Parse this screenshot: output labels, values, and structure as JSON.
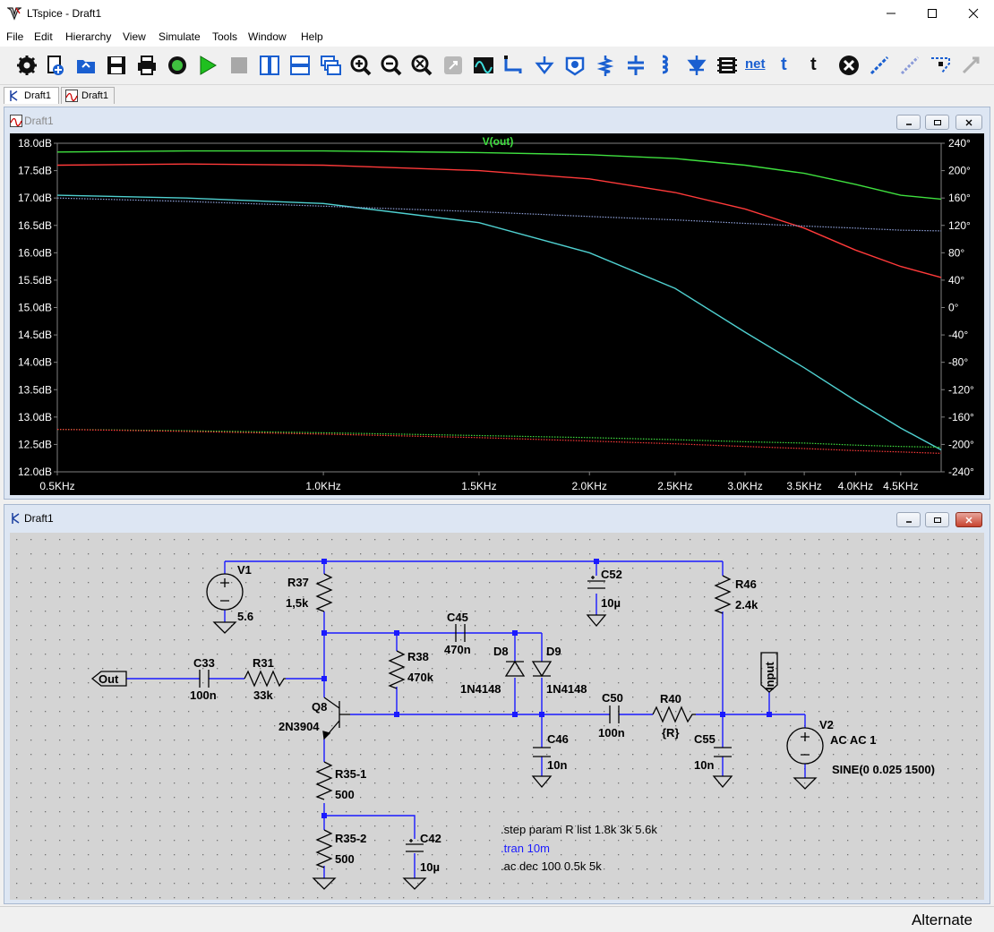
{
  "window": {
    "title": "LTspice - Draft1"
  },
  "menu": [
    "File",
    "Edit",
    "Hierarchy",
    "View",
    "Simulate",
    "Tools",
    "Window",
    "Help"
  ],
  "toolbar": {
    "net_label": "net",
    "t_label": "t"
  },
  "tabs": [
    "Draft1",
    "Draft1"
  ],
  "plot_window": {
    "title": "Draft1"
  },
  "schematic_window": {
    "title": "Draft1"
  },
  "status": {
    "text": "Alternate"
  },
  "chart_data": {
    "type": "line",
    "title": "V(out)",
    "xscale": "log",
    "xlim": [
      500,
      5000
    ],
    "x_ticks": [
      "0.5KHz",
      "1.0KHz",
      "1.5KHz",
      "2.0KHz",
      "2.5KHz",
      "3.0KHz",
      "3.5KHz",
      "4.0KHz",
      "4.5KHz"
    ],
    "y_left_ticks": [
      "18.0dB",
      "17.5dB",
      "17.0dB",
      "16.5dB",
      "16.0dB",
      "15.5dB",
      "15.0dB",
      "14.5dB",
      "14.0dB",
      "13.5dB",
      "13.0dB",
      "12.5dB",
      "12.0dB"
    ],
    "y_right_ticks": [
      "240°",
      "200°",
      "160°",
      "120°",
      "80°",
      "40°",
      "0°",
      "-40°",
      "-80°",
      "-120°",
      "-160°",
      "-200°",
      "-240°"
    ],
    "ylim_left": [
      12,
      18
    ],
    "ylim_right": [
      -240,
      240
    ],
    "x": [
      500,
      700,
      1000,
      1500,
      2000,
      2500,
      3000,
      3500,
      4000,
      4500,
      5000
    ],
    "series": [
      {
        "color": "#3fe03f",
        "axis": "left",
        "style": "solid",
        "values": [
          17.84,
          17.86,
          17.86,
          17.83,
          17.79,
          17.72,
          17.6,
          17.45,
          17.25,
          17.05,
          16.98
        ]
      },
      {
        "color": "#ff3a3a",
        "axis": "left",
        "style": "solid",
        "values": [
          17.6,
          17.62,
          17.6,
          17.5,
          17.35,
          17.1,
          16.8,
          16.45,
          16.05,
          15.75,
          15.55
        ]
      },
      {
        "color": "#4fd0d0",
        "axis": "left",
        "style": "solid",
        "values": [
          17.05,
          17.0,
          16.9,
          16.55,
          16.0,
          15.35,
          14.55,
          13.9,
          13.3,
          12.8,
          12.4
        ]
      },
      {
        "color": "#8ea0d8",
        "axis": "right",
        "style": "dotted",
        "values": [
          160,
          155,
          148,
          140,
          133,
          128,
          123,
          119,
          116,
          113,
          112
        ]
      },
      {
        "color": "#3fe03f",
        "axis": "right",
        "style": "dotted",
        "values": [
          -178,
          -180,
          -183,
          -187,
          -190,
          -193,
          -196,
          -198,
          -201,
          -203,
          -204
        ]
      },
      {
        "color": "#ff3a3a",
        "axis": "right",
        "style": "dotted",
        "values": [
          -178,
          -181,
          -185,
          -190,
          -195,
          -199,
          -203,
          -206,
          -209,
          -211,
          -213
        ]
      }
    ]
  },
  "schematic": {
    "labels": {
      "V1": "V1",
      "V1v": "5.6",
      "R37": "R37",
      "R37v": "1,5k",
      "C52": "C52",
      "C52v": "10µ",
      "R46": "R46",
      "R46v": "2.4k",
      "C45": "C45",
      "C45v": "470n",
      "R38": "R38",
      "R38v": "470k",
      "D8": "D8",
      "D9": "D9",
      "D8m": "1N4148",
      "D9m": "1N4148",
      "C33": "C33",
      "C33v": "100n",
      "R31": "R31",
      "R31v": "33k",
      "Out": "Out",
      "Q8": "Q8",
      "Q8m": "2N3904",
      "C50": "C50",
      "C50v": "100n",
      "R40": "R40",
      "R40v": "{R}",
      "C46": "C46",
      "C46v": "10n",
      "C55": "C55",
      "C55v": "10n",
      "Input": "Input",
      "V2": "V2",
      "V2a": "AC AC 1",
      "V2b": "SINE(0 0.025 1500)",
      "R351": "R35-1",
      "R351v": "500",
      "R352": "R35-2",
      "R352v": "500",
      "C42": "C42",
      "C42v": "10µ"
    },
    "directives": [
      ".step param R list 1.8k 3k 5.6k",
      ".tran 10m",
      ".ac dec 100 0.5k 5k"
    ]
  }
}
